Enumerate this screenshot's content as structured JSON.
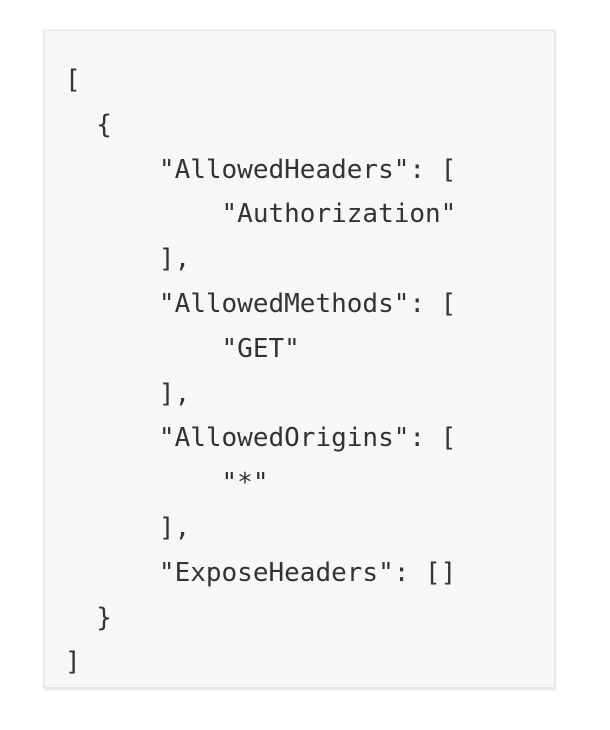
{
  "code": {
    "lines": [
      "[",
      "  {",
      "      \"AllowedHeaders\": [",
      "          \"Authorization\"",
      "      ],",
      "      \"AllowedMethods\": [",
      "          \"GET\"",
      "      ],",
      "      \"AllowedOrigins\": [",
      "          \"*\"",
      "      ],",
      "      \"ExposeHeaders\": []",
      "  }",
      "]"
    ]
  }
}
